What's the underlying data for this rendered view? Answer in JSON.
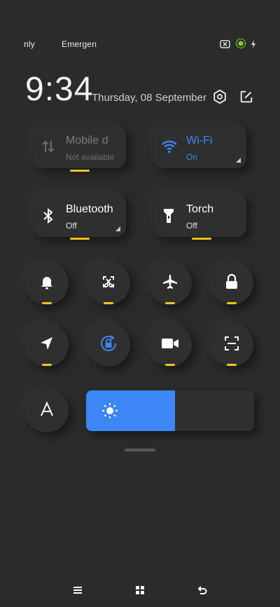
{
  "status_bar": {
    "left_text_1": "nly",
    "left_text_2": "Emergen",
    "icons": [
      "battery-x-icon",
      "battery-charging-icon",
      "bolt-icon"
    ]
  },
  "header": {
    "time": "9:34",
    "date": "Thursday, 08 September",
    "settings_icon": "gear-hexagon-icon",
    "edit_icon": "edit-icon"
  },
  "tiles": [
    {
      "name": "Mobile d",
      "state": "Not available",
      "icon": "mobile-data-icon",
      "active": false
    },
    {
      "name": "Wi-Fi",
      "state": "On",
      "icon": "wifi-icon",
      "active": true
    },
    {
      "name": "Bluetooth",
      "state": "Off",
      "icon": "bluetooth-icon",
      "active": false
    },
    {
      "name": "Torch",
      "state": "Off",
      "icon": "torch-icon",
      "active": false
    }
  ],
  "toggles_row1": [
    "bell-icon",
    "screenshot-icon",
    "airplane-icon",
    "lock-icon"
  ],
  "toggles_row2": [
    "location-icon",
    "rotation-lock-icon",
    "video-icon",
    "scanner-icon"
  ],
  "auto_brightness_icon": "auto-brightness-icon",
  "brightness": {
    "level": 0.53,
    "icon": "sun-icon"
  },
  "colors": {
    "accent_blue": "#3d86f5",
    "indicator_yellow": "#f5c518",
    "background": "#2b2b2b"
  },
  "nav_bar": [
    "menu-icon",
    "home-icon",
    "back-icon"
  ]
}
